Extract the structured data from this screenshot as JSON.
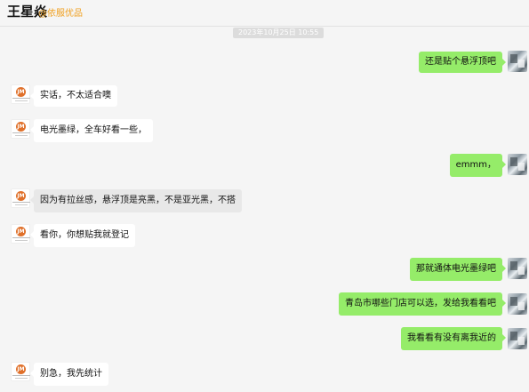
{
  "header": {
    "name": "王星焱",
    "org": "@依服优品"
  },
  "timestamp": "2023年10月25日 10:55",
  "colors": {
    "outgoing_bubble": "#95ec69",
    "incoming_bubble": "#ffffff",
    "org_text": "#f0a020"
  },
  "messages": [
    {
      "side": "out",
      "text": "还是贴个悬浮顶吧"
    },
    {
      "side": "in",
      "text": "实话，不太适合噢"
    },
    {
      "side": "in",
      "text": "电光墨绿，全车好看一些，"
    },
    {
      "side": "out",
      "text": "emmm，"
    },
    {
      "side": "in",
      "text": "因为有拉丝感，悬浮顶是亮黑，不是亚光黑，不搭"
    },
    {
      "side": "in",
      "text": "看你，你想贴我就登记"
    },
    {
      "side": "out",
      "text": "那就通体电光墨绿吧"
    },
    {
      "side": "out",
      "text": "青岛市哪些门店可以选，发给我看看吧"
    },
    {
      "side": "out",
      "text": "我看看有没有离我近的"
    },
    {
      "side": "in",
      "text": "别急，我先统计"
    }
  ],
  "avatar_left_mark": "JM"
}
